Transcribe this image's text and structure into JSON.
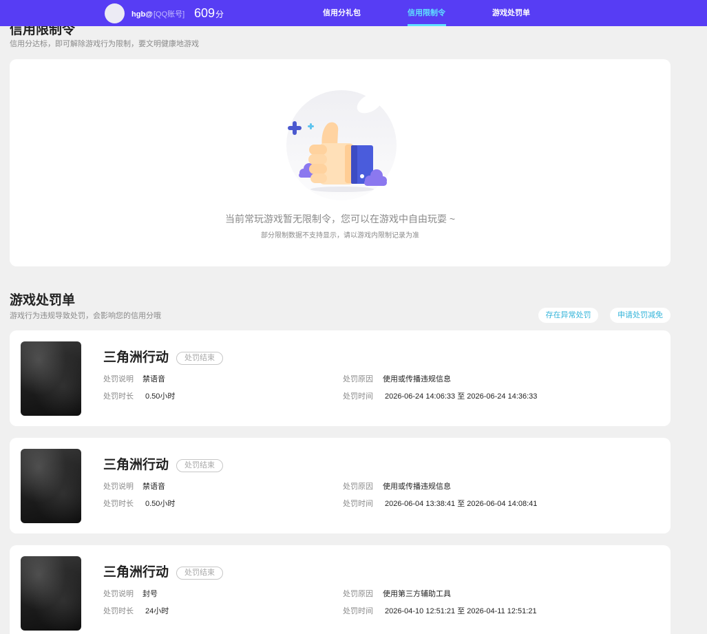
{
  "header": {
    "username": "hgb@",
    "account_type": "[QQ账号]",
    "score": "609",
    "score_unit": "分",
    "tabs": [
      {
        "label": "信用分礼包",
        "active": false
      },
      {
        "label": "信用限制令",
        "active": true
      },
      {
        "label": "游戏处罚单",
        "active": false
      }
    ]
  },
  "restriction": {
    "title": "信用限制令",
    "subtitle": "信用分达标，即可解除游戏行为限制，要文明健康地游戏",
    "empty_text": "当前常玩游戏暂无限制令，您可以在游戏中自由玩耍 ~",
    "empty_note": "部分限制数据不支持显示，请以游戏内限制记录为准",
    "illustration": "thumbs-up-icon"
  },
  "penalties": {
    "title": "游戏处罚单",
    "subtitle": "游戏行为违规导致处罚，会影响您的信用分哦",
    "actions": [
      "存在异常处罚",
      "申请处罚减免"
    ],
    "labels": {
      "desc": "处罚说明",
      "reason": "处罚原因",
      "duration": "处罚时长",
      "time": "处罚时间"
    },
    "items": [
      {
        "game": "三角洲行动",
        "status": "处罚结束",
        "desc": "禁语音",
        "reason": "使用或传播违规信息",
        "duration": "0.50小时",
        "time": "2026-06-24 14:06:33 至 2026-06-24 14:36:33"
      },
      {
        "game": "三角洲行动",
        "status": "处罚结束",
        "desc": "禁语音",
        "reason": "使用或传播违规信息",
        "duration": "0.50小时",
        "time": "2026-06-04 13:38:41 至 2026-06-04 14:08:41"
      },
      {
        "game": "三角洲行动",
        "status": "处罚结束",
        "desc": "封号",
        "reason": "使用第三方辅助工具",
        "duration": "24小时",
        "time": "2026-04-10 12:51:21 至 2026-04-11 12:51:21"
      }
    ]
  },
  "colors": {
    "header_bg": "#573df4",
    "active_tab": "#5fe0ff",
    "action_text": "#35b5da",
    "page_bg": "#f0f0f0"
  }
}
